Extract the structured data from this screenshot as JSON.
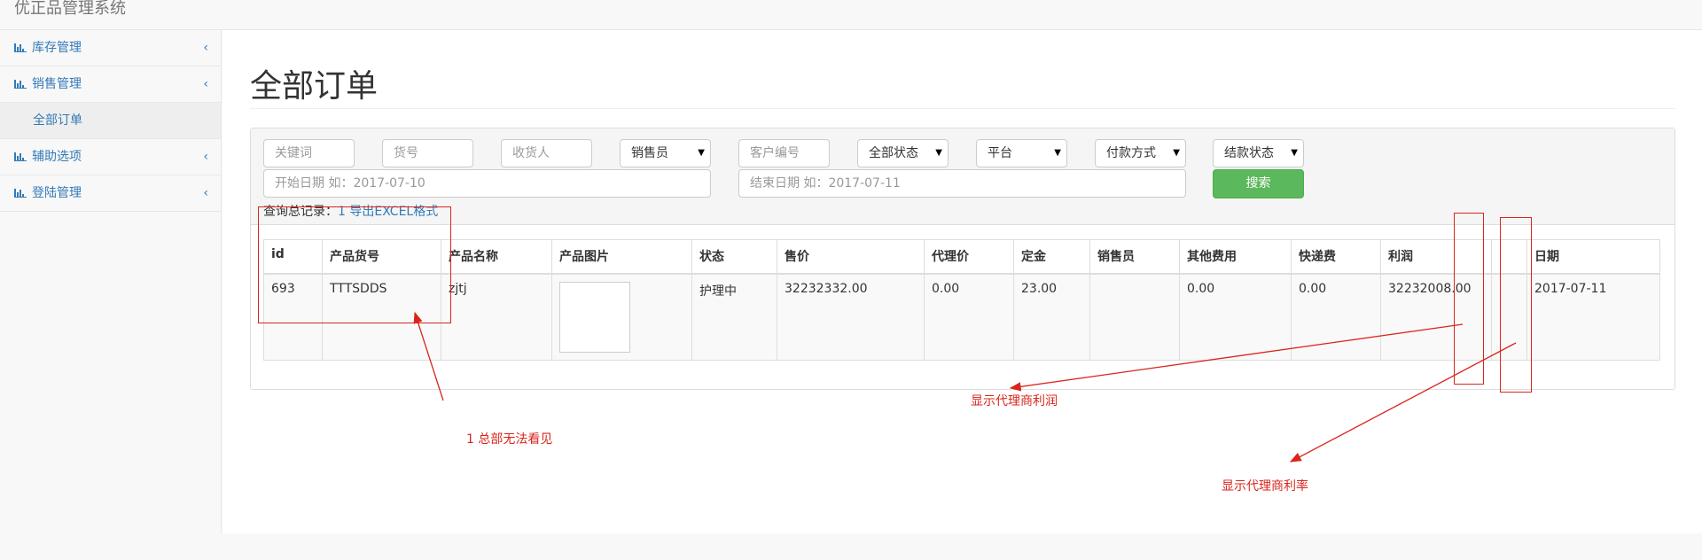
{
  "app": {
    "title": "优正品管理系统"
  },
  "sidebar": {
    "items": [
      {
        "label": "库存管理",
        "chevron": "‹"
      },
      {
        "label": "销售管理",
        "chevron": "‹"
      },
      {
        "label": "全部订单",
        "sub": true
      },
      {
        "label": "辅助选项",
        "chevron": "‹"
      },
      {
        "label": "登陆管理",
        "chevron": "‹"
      }
    ],
    "icon": "bar-chart-icon"
  },
  "page": {
    "title": "全部订单"
  },
  "filters": {
    "keyword_placeholder": "关键词",
    "sku_placeholder": "货号",
    "receiver_placeholder": "收货人",
    "salesperson_selected": "销售员",
    "customer_placeholder": "客户编号",
    "status_selected": "全部状态",
    "platform_selected": "平台",
    "payment_selected": "付款方式",
    "settlement_selected": "结款状态",
    "start_date_placeholder": "开始日期 如：2017-07-10",
    "end_date_placeholder": "结束日期 如：2017-07-11",
    "search_label": "搜索",
    "caret": "▼"
  },
  "summary": {
    "prefix": "查询总记录：",
    "count": "1",
    "export_label": "导出EXCEL格式"
  },
  "table": {
    "columns": [
      "id",
      "产品货号",
      "产品名称",
      "产品图片",
      "状态",
      "售价",
      "代理价",
      "定金",
      "销售员",
      "其他费用",
      "快递费",
      "利润",
      "",
      "日期"
    ],
    "rows": [
      [
        "693",
        "TTTSDDS",
        "zjtj",
        "",
        "护理中",
        "32232332.00",
        "0.00",
        "23.00",
        "",
        "0.00",
        "0.00",
        "32232008.00",
        "",
        "2017-07-11"
      ]
    ]
  },
  "annotations": {
    "note1": "1  总部无法看见",
    "note2": "显示代理商利润",
    "note3": "显示代理商利率",
    "color": "#d9251c"
  }
}
